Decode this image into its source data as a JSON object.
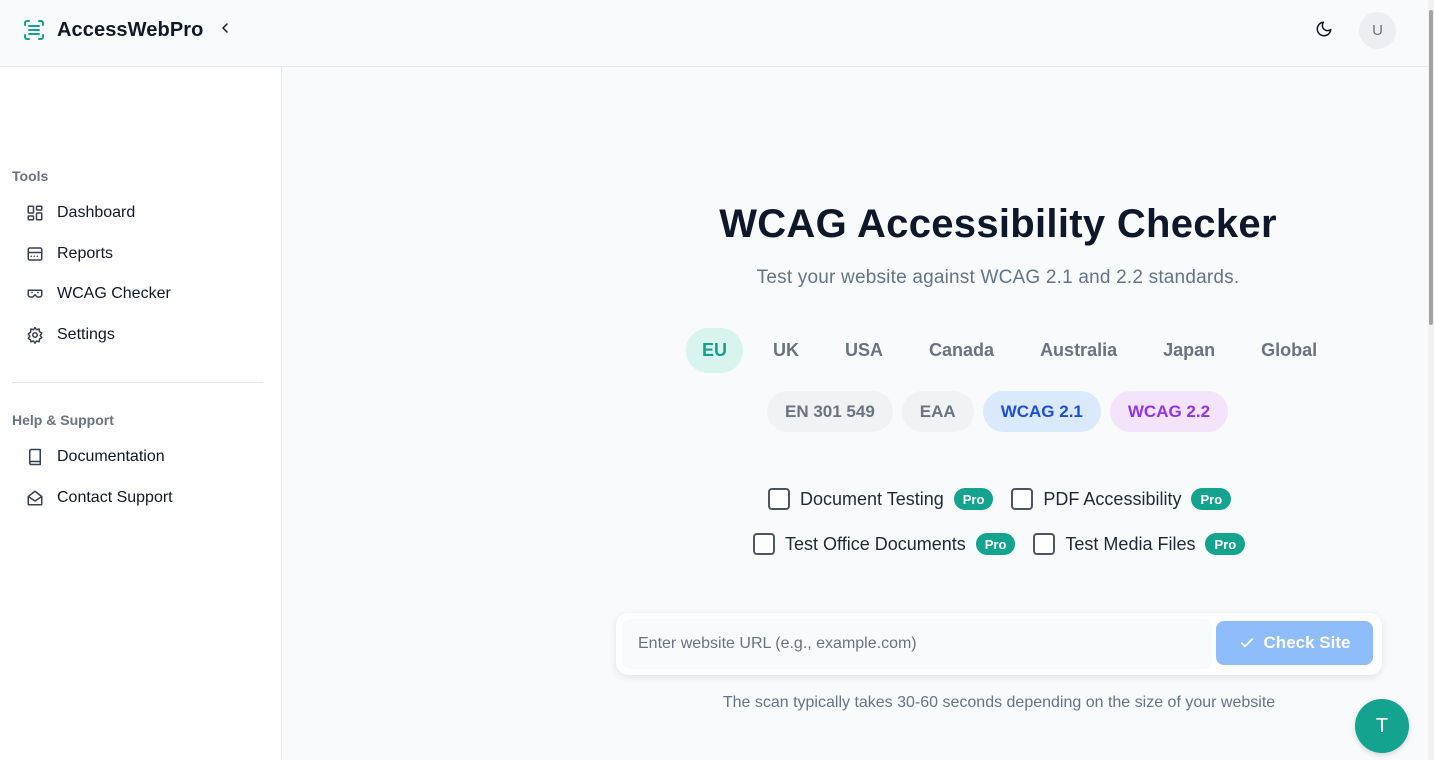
{
  "header": {
    "app_name": "AccessWebPro",
    "collapse_icon": "chevron-left-icon",
    "theme_icon": "moon-icon",
    "avatar_initial": "U"
  },
  "sidebar": {
    "tools_title": "Tools",
    "tools": [
      {
        "label": "Dashboard",
        "icon": "dashboard-icon"
      },
      {
        "label": "Reports",
        "icon": "reports-icon"
      },
      {
        "label": "WCAG Checker",
        "icon": "wcag-checker-icon"
      },
      {
        "label": "Settings",
        "icon": "gear-icon"
      }
    ],
    "help_title": "Help & Support",
    "help": [
      {
        "label": "Documentation",
        "icon": "book-icon"
      },
      {
        "label": "Contact Support",
        "icon": "mail-open-icon"
      }
    ]
  },
  "main": {
    "title": "WCAG Accessibility Checker",
    "subtitle": "Test your website against WCAG 2.1 and 2.2 standards.",
    "regions": [
      "EU",
      "UK",
      "USA",
      "Canada",
      "Australia",
      "Japan",
      "Global"
    ],
    "active_region": "EU",
    "standards": [
      "EN 301 549",
      "EAA",
      "WCAG 2.1",
      "WCAG 2.2"
    ],
    "options": [
      {
        "label": "Document Testing",
        "badge": "Pro",
        "checked": false
      },
      {
        "label": "PDF Accessibility",
        "badge": "Pro",
        "checked": false
      },
      {
        "label": "Test Office Documents",
        "badge": "Pro",
        "checked": false
      },
      {
        "label": "Test Media Files",
        "badge": "Pro",
        "checked": false
      }
    ],
    "url_placeholder": "Enter website URL (e.g., example.com)",
    "url_value": "",
    "check_button": "Check Site",
    "scan_note": "The scan typically takes 30-60 seconds depending on the size of your website"
  },
  "fab_label": "T",
  "colors": {
    "accent": "#14a38f",
    "active_tab_bg": "#d9f3ee",
    "check_button": "#8fbcfb",
    "wcag21": "#1d4ed8",
    "wcag22": "#9333ea"
  }
}
